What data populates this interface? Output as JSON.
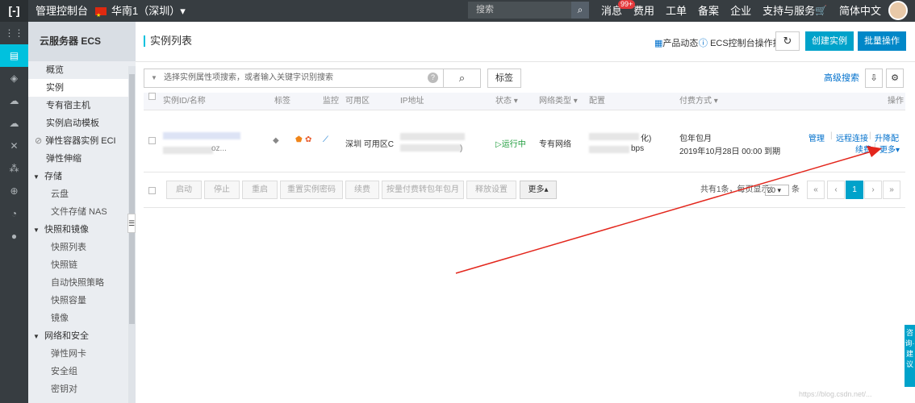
{
  "topbar": {
    "logo": "[-]",
    "console": "管理控制台",
    "region": "华南1（深圳）▾",
    "search_placeholder": "搜索",
    "nav": [
      "消息",
      "费用",
      "工单",
      "备案",
      "企业",
      "支持与服务"
    ],
    "badge": "99+",
    "lang": "简体中文"
  },
  "rail_icons": [
    "grid-icon",
    "server-icon",
    "database-icon",
    "cloud-icon",
    "cloud-upload-icon",
    "cross-icon",
    "nodes-icon",
    "globe-icon",
    "cycle-icon",
    "circle-icon"
  ],
  "sidebar": {
    "header": "云服务器 ECS",
    "items": [
      "概览",
      "实例",
      "专有宿主机",
      "实例启动模板",
      "弹性容器实例 ECI",
      "弹性伸缩"
    ],
    "groups": [
      {
        "label": "存储",
        "subs": [
          "云盘",
          "文件存储 NAS"
        ]
      },
      {
        "label": "快照和镜像",
        "subs": [
          "快照列表",
          "快照链",
          "自动快照策略",
          "快照容量",
          "镜像"
        ]
      },
      {
        "label": "网络和安全",
        "subs": [
          "弹性网卡",
          "安全组",
          "密钥对"
        ]
      }
    ]
  },
  "main": {
    "title": "实例列表",
    "product_news": "产品动态",
    "guide": "ECS控制台操作指南",
    "refresh": "↻",
    "create": "创建实例",
    "batch": "批量操作",
    "search_placeholder": "选择实例属性项搜索，或者输入关键字识别搜索",
    "tag_btn": "标签",
    "advanced": "高级搜索"
  },
  "table": {
    "headers": [
      "实例ID/名称",
      "标签",
      "监控",
      "可用区",
      "IP地址",
      "状态 ▾",
      "网络类型 ▾",
      "配置",
      "付费方式 ▾",
      "操作"
    ],
    "row": {
      "name_tail": "oz...",
      "zone": "深圳 可用区C",
      "ip_tail": ")",
      "status": "运行中",
      "network": "专有网络",
      "config_line1": "化)",
      "config_line2": "bps",
      "pay_line1": "包年包月",
      "pay_line2": "2019年10月28日 00:00 到期",
      "ops": [
        "管理",
        "远程连接",
        "升降配",
        "续费",
        "更多▾"
      ]
    },
    "tools": [
      "启动",
      "停止",
      "重启",
      "重置实例密码",
      "续费",
      "按量付费转包年包月",
      "释放设置",
      "更多▴"
    ],
    "pagination": {
      "summary": "共有1条，每页显示：",
      "per_page": "20",
      "unit": "条",
      "pages": [
        "«",
        "‹",
        "1",
        "›",
        "»"
      ]
    }
  },
  "consult": "咨询·建议",
  "watermark": "https://blog.csdn.net/..."
}
